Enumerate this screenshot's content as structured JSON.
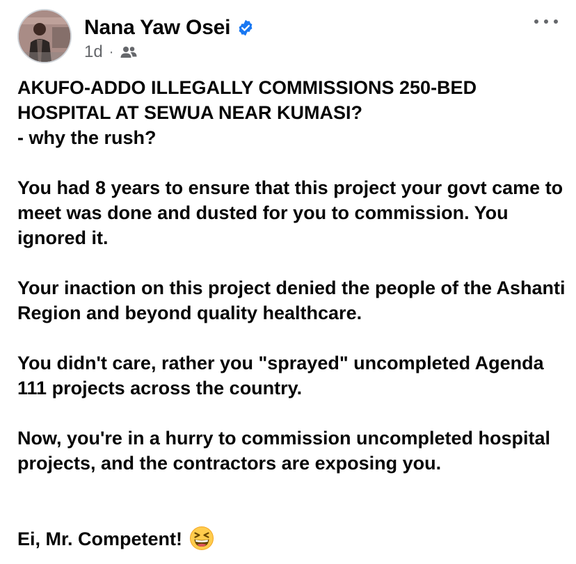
{
  "post": {
    "author": {
      "name": "Nana Yaw Osei",
      "verified": true
    },
    "meta": {
      "time": "1d",
      "separator": "·",
      "audience_icon": "friends-icon"
    },
    "menu_icon": "more-options-icon",
    "paragraphs": [
      "AKUFO-ADDO ILLEGALLY COMMISSIONS 250-BED HOSPITAL AT SEWUA NEAR KUMASI?\n- why the rush?",
      "You had 8 years to ensure that this project your govt came to meet was done and dusted for you to commission. You ignored it.",
      "Your  inaction on this project denied the people of the Ashanti Region and beyond quality healthcare.",
      "You didn't care, rather you \"sprayed\" uncompleted Agenda 111 projects across the country.",
      "Now, you're in a hurry to commission uncompleted hospital projects, and the contractors are exposing you."
    ],
    "closing_text": "Ei, Mr. Competent!",
    "closing_emoji": "grinning-squinting-face-emoji"
  },
  "colors": {
    "text": "#050505",
    "secondary_text": "#65676b",
    "verified_badge": "#1877f2"
  }
}
